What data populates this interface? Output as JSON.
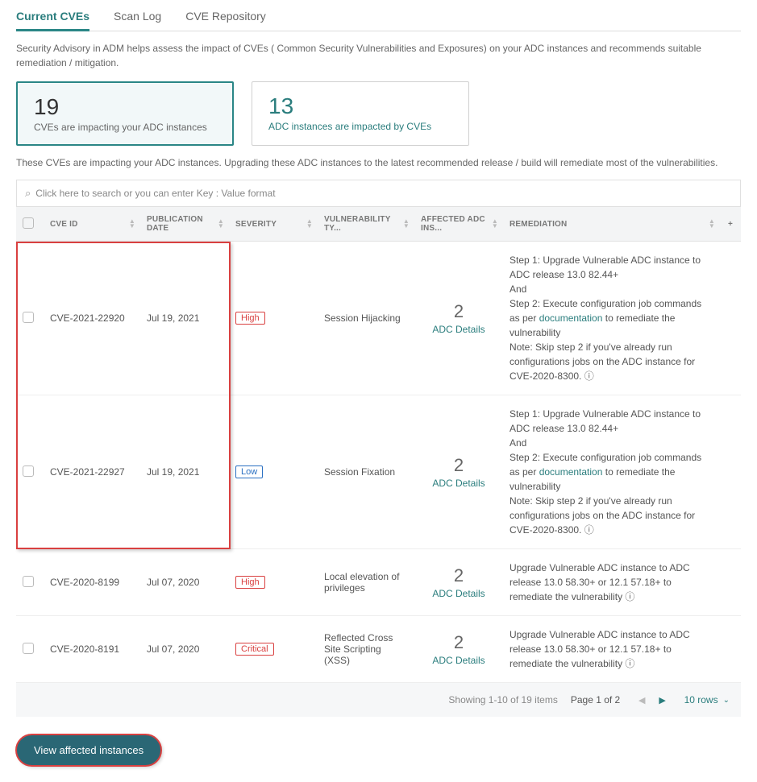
{
  "tabs": {
    "current": "Current CVEs",
    "scanlog": "Scan Log",
    "repo": "CVE Repository"
  },
  "description": "Security Advisory in ADM helps assess the impact of CVEs ( Common Security Vulnerabilities and Exposures) on your ADC instances and recommends suitable remediation / mitigation.",
  "cards": {
    "cve_count": "19",
    "cve_label": "CVEs are impacting your ADC instances",
    "inst_count": "13",
    "inst_label": "ADC instances are impacted by CVEs"
  },
  "subdesc": "These CVEs are impacting your ADC instances. Upgrading these ADC instances to the latest recommended release / build will remediate most of the vulnerabilities.",
  "search_placeholder": "Click here to search or you can enter Key : Value format",
  "columns": {
    "cveid": "CVE ID",
    "pubdate": "PUBLICATION DATE",
    "severity": "SEVERITY",
    "vulntype": "VULNERABILITY TY...",
    "affected": "AFFECTED ADC INS...",
    "remediation": "REMEDIATION"
  },
  "rows": [
    {
      "cveid": "CVE-2021-22920",
      "pubdate": "Jul 19, 2021",
      "severity": "High",
      "severity_class": "high",
      "vuln": "Session Hijacking",
      "count": "2",
      "details": "ADC Details",
      "rem_step1": "Step 1: Upgrade Vulnerable ADC instance to ADC release 13.0 82.44+",
      "rem_and": "And",
      "rem_step2_a": "Step 2: Execute configuration job commands as per ",
      "rem_step2_link": "documentation",
      "rem_step2_b": " to remediate the vulnerability",
      "rem_note": "Note: Skip step 2 if you've already run configurations jobs on the ADC instance for CVE-2020-8300. ⓘ",
      "multi": true
    },
    {
      "cveid": "CVE-2021-22927",
      "pubdate": "Jul 19, 2021",
      "severity": "Low",
      "severity_class": "low",
      "vuln": "Session Fixation",
      "count": "2",
      "details": "ADC Details",
      "rem_step1": "Step 1: Upgrade Vulnerable ADC instance to ADC release 13.0 82.44+",
      "rem_and": "And",
      "rem_step2_a": "Step 2: Execute configuration job commands as per ",
      "rem_step2_link": "documentation",
      "rem_step2_b": " to remediate the vulnerability",
      "rem_note": "Note: Skip step 2 if you've already run configurations jobs on the ADC instance for CVE-2020-8300. ⓘ",
      "multi": true
    },
    {
      "cveid": "CVE-2020-8199",
      "pubdate": "Jul 07, 2020",
      "severity": "High",
      "severity_class": "high",
      "vuln": "Local elevation of privileges",
      "count": "2",
      "details": "ADC Details",
      "rem_simple": "Upgrade Vulnerable ADC instance to ADC release 13.0 58.30+ or 12.1 57.18+ to remediate the vulnerability ⓘ",
      "multi": false
    },
    {
      "cveid": "CVE-2020-8191",
      "pubdate": "Jul 07, 2020",
      "severity": "Critical",
      "severity_class": "critical",
      "vuln": "Reflected Cross Site Scripting (XSS)",
      "count": "2",
      "details": "ADC Details",
      "rem_simple": "Upgrade Vulnerable ADC instance to ADC release 13.0 58.30+ or 12.1 57.18+ to remediate the vulnerability ⓘ",
      "multi": false
    }
  ],
  "pager": {
    "showing": "Showing 1-10 of 19 items",
    "page": "Page 1 of 2",
    "rows": "10 rows"
  },
  "footer_button": "View affected instances"
}
